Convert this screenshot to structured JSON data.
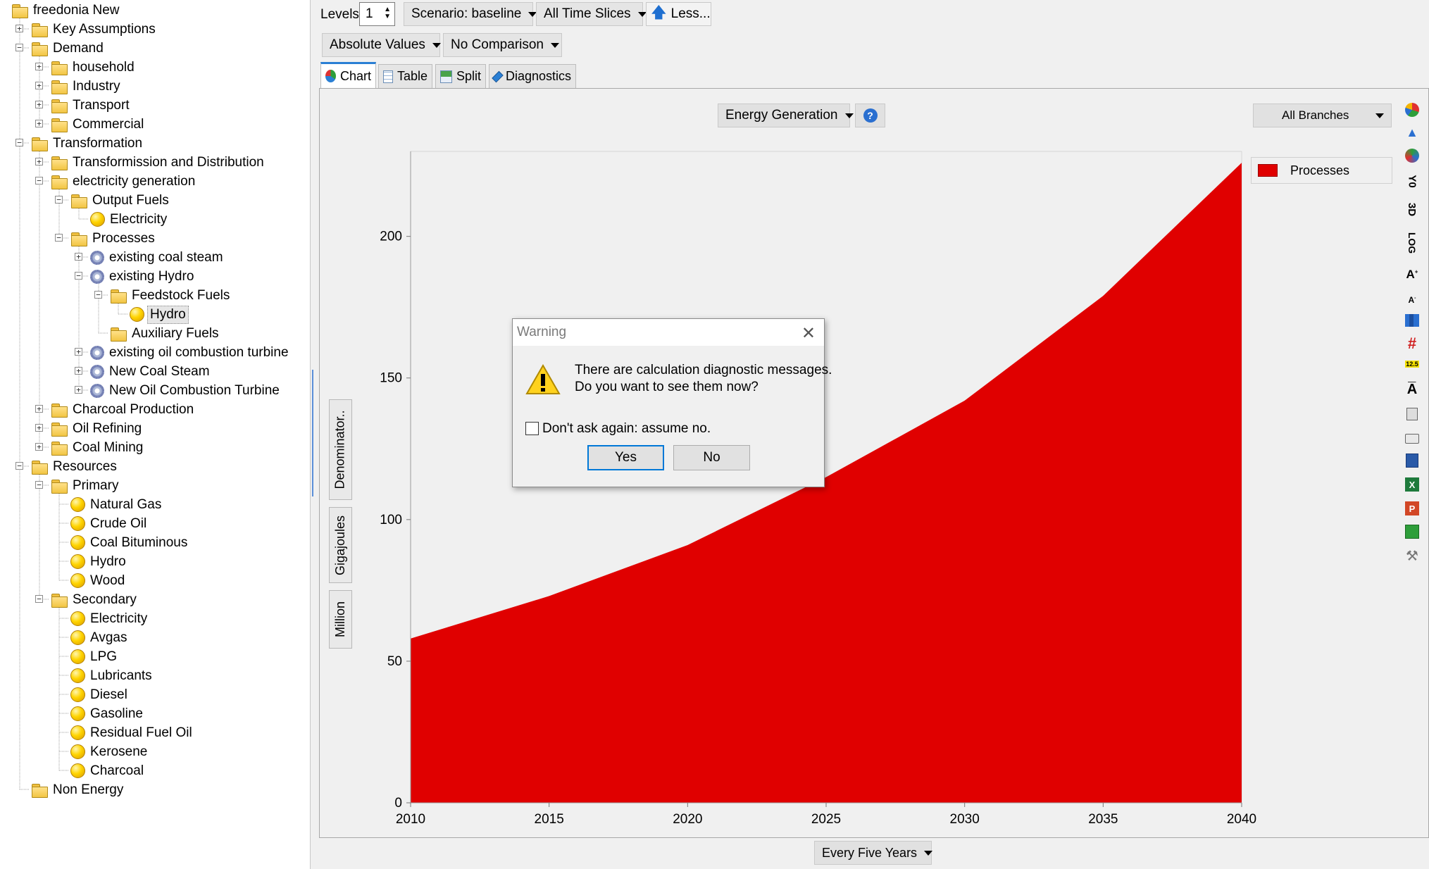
{
  "toolbar": {
    "levels_label": "Levels:",
    "levels_value": "1",
    "scenario": "Scenario: baseline",
    "time_slices": "All Time Slices",
    "less": "Less...",
    "absolute_values": "Absolute Values",
    "comparison": "No Comparison"
  },
  "tabs": [
    {
      "label": "Chart",
      "active": true
    },
    {
      "label": "Table",
      "active": false
    },
    {
      "label": "Split",
      "active": false
    },
    {
      "label": "Diagnostics",
      "active": false
    }
  ],
  "chart_controls": {
    "variable": "Energy Generation",
    "branches": "All Branches",
    "period": "Every Five Years",
    "vertical_tabs": [
      "Denominator..",
      "Gigajoules",
      "Million"
    ]
  },
  "side_icons": [
    "pie-chart-icon",
    "chart-type-icon",
    "color-palette-icon",
    "axis-zero-icon",
    "3d-icon",
    "log-icon",
    "font-larger-icon",
    "font-smaller-icon",
    "chart-options-icon",
    "grid-icon",
    "data-labels-icon",
    "legend-icon",
    "copy-icon",
    "print-icon",
    "word-export-icon",
    "excel-export-icon",
    "powerpoint-export-icon",
    "save-icon",
    "settings-wrench-icon"
  ],
  "side_icon_labels": {
    "axis_zero": "Y0",
    "three_d": "3D",
    "log": "LOG",
    "labels": "12.5"
  },
  "chart_data": {
    "type": "area",
    "x": [
      2010,
      2015,
      2020,
      2025,
      2030,
      2035,
      2040
    ],
    "series": [
      {
        "name": "Processes",
        "values": [
          58,
          73,
          91,
          115,
          142,
          179,
          226
        ],
        "color": "#e00000"
      }
    ],
    "x_ticks": [
      "2010",
      "2015",
      "2020",
      "2025",
      "2030",
      "2035",
      "2040"
    ],
    "y_ticks": [
      "0",
      "50",
      "100",
      "150",
      "200"
    ],
    "ylim": [
      0,
      230
    ],
    "xlim": [
      2010,
      2040
    ],
    "legend_position": "right",
    "grid": false
  },
  "dialog": {
    "title": "Warning",
    "message_line1": "There are calculation diagnostic messages.",
    "message_line2": "Do you want to see them now?",
    "checkbox_label": "Don't ask again: assume no.",
    "checkbox_checked": false,
    "yes": "Yes",
    "no": "No"
  },
  "tree": [
    {
      "label": "freedonia New",
      "icon": "folder",
      "level": 0,
      "exp": null
    },
    {
      "label": "Key Assumptions",
      "icon": "folder",
      "level": 1,
      "exp": "+"
    },
    {
      "label": "Demand",
      "icon": "folder",
      "level": 1,
      "exp": "-"
    },
    {
      "label": "household",
      "icon": "folder",
      "level": 2,
      "exp": "+"
    },
    {
      "label": "Industry",
      "icon": "folder",
      "level": 2,
      "exp": "+"
    },
    {
      "label": "Transport",
      "icon": "folder",
      "level": 2,
      "exp": "+"
    },
    {
      "label": "Commercial",
      "icon": "folder",
      "level": 2,
      "exp": "+"
    },
    {
      "label": "Transformation",
      "icon": "folder",
      "level": 1,
      "exp": "-"
    },
    {
      "label": "Transformission and Distribution",
      "icon": "folder",
      "level": 2,
      "exp": "+"
    },
    {
      "label": "electricity generation",
      "icon": "folder",
      "level": 2,
      "exp": "-"
    },
    {
      "label": "Output Fuels",
      "icon": "folder",
      "level": 3,
      "exp": "-"
    },
    {
      "label": "Electricity",
      "icon": "ball",
      "level": 4,
      "exp": null
    },
    {
      "label": "Processes",
      "icon": "folder",
      "level": 3,
      "exp": "-"
    },
    {
      "label": "existing coal steam",
      "icon": "gear",
      "level": 4,
      "exp": "+"
    },
    {
      "label": "existing Hydro",
      "icon": "gear",
      "level": 4,
      "exp": "-"
    },
    {
      "label": "Feedstock Fuels",
      "icon": "folder",
      "level": 5,
      "exp": "-"
    },
    {
      "label": "Hydro",
      "icon": "ball",
      "level": 6,
      "exp": null,
      "selected": true
    },
    {
      "label": "Auxiliary Fuels",
      "icon": "folder",
      "level": 5,
      "exp": null
    },
    {
      "label": "existing oil combustion turbine",
      "icon": "gear",
      "level": 4,
      "exp": "+"
    },
    {
      "label": "New Coal Steam",
      "icon": "gear",
      "level": 4,
      "exp": "+"
    },
    {
      "label": "New Oil Combustion Turbine",
      "icon": "gear",
      "level": 4,
      "exp": "+"
    },
    {
      "label": "Charcoal Production",
      "icon": "folder",
      "level": 2,
      "exp": "+"
    },
    {
      "label": "Oil Refining",
      "icon": "folder",
      "level": 2,
      "exp": "+"
    },
    {
      "label": "Coal Mining",
      "icon": "folder",
      "level": 2,
      "exp": "+"
    },
    {
      "label": "Resources",
      "icon": "folder",
      "level": 1,
      "exp": "-"
    },
    {
      "label": "Primary",
      "icon": "folder",
      "level": 2,
      "exp": "-"
    },
    {
      "label": "Natural Gas",
      "icon": "ball",
      "level": 3,
      "exp": null
    },
    {
      "label": "Crude Oil",
      "icon": "ball",
      "level": 3,
      "exp": null
    },
    {
      "label": "Coal Bituminous",
      "icon": "ball",
      "level": 3,
      "exp": null
    },
    {
      "label": "Hydro",
      "icon": "ball",
      "level": 3,
      "exp": null
    },
    {
      "label": "Wood",
      "icon": "ball",
      "level": 3,
      "exp": null
    },
    {
      "label": "Secondary",
      "icon": "folder",
      "level": 2,
      "exp": "-"
    },
    {
      "label": "Electricity",
      "icon": "ball",
      "level": 3,
      "exp": null
    },
    {
      "label": "Avgas",
      "icon": "ball",
      "level": 3,
      "exp": null
    },
    {
      "label": "LPG",
      "icon": "ball",
      "level": 3,
      "exp": null
    },
    {
      "label": "Lubricants",
      "icon": "ball",
      "level": 3,
      "exp": null
    },
    {
      "label": "Diesel",
      "icon": "ball",
      "level": 3,
      "exp": null
    },
    {
      "label": "Gasoline",
      "icon": "ball",
      "level": 3,
      "exp": null
    },
    {
      "label": "Residual Fuel Oil",
      "icon": "ball",
      "level": 3,
      "exp": null
    },
    {
      "label": "Kerosene",
      "icon": "ball",
      "level": 3,
      "exp": null
    },
    {
      "label": "Charcoal",
      "icon": "ball",
      "level": 3,
      "exp": null
    },
    {
      "label": "Non Energy",
      "icon": "folder",
      "level": 1,
      "exp": null
    }
  ]
}
